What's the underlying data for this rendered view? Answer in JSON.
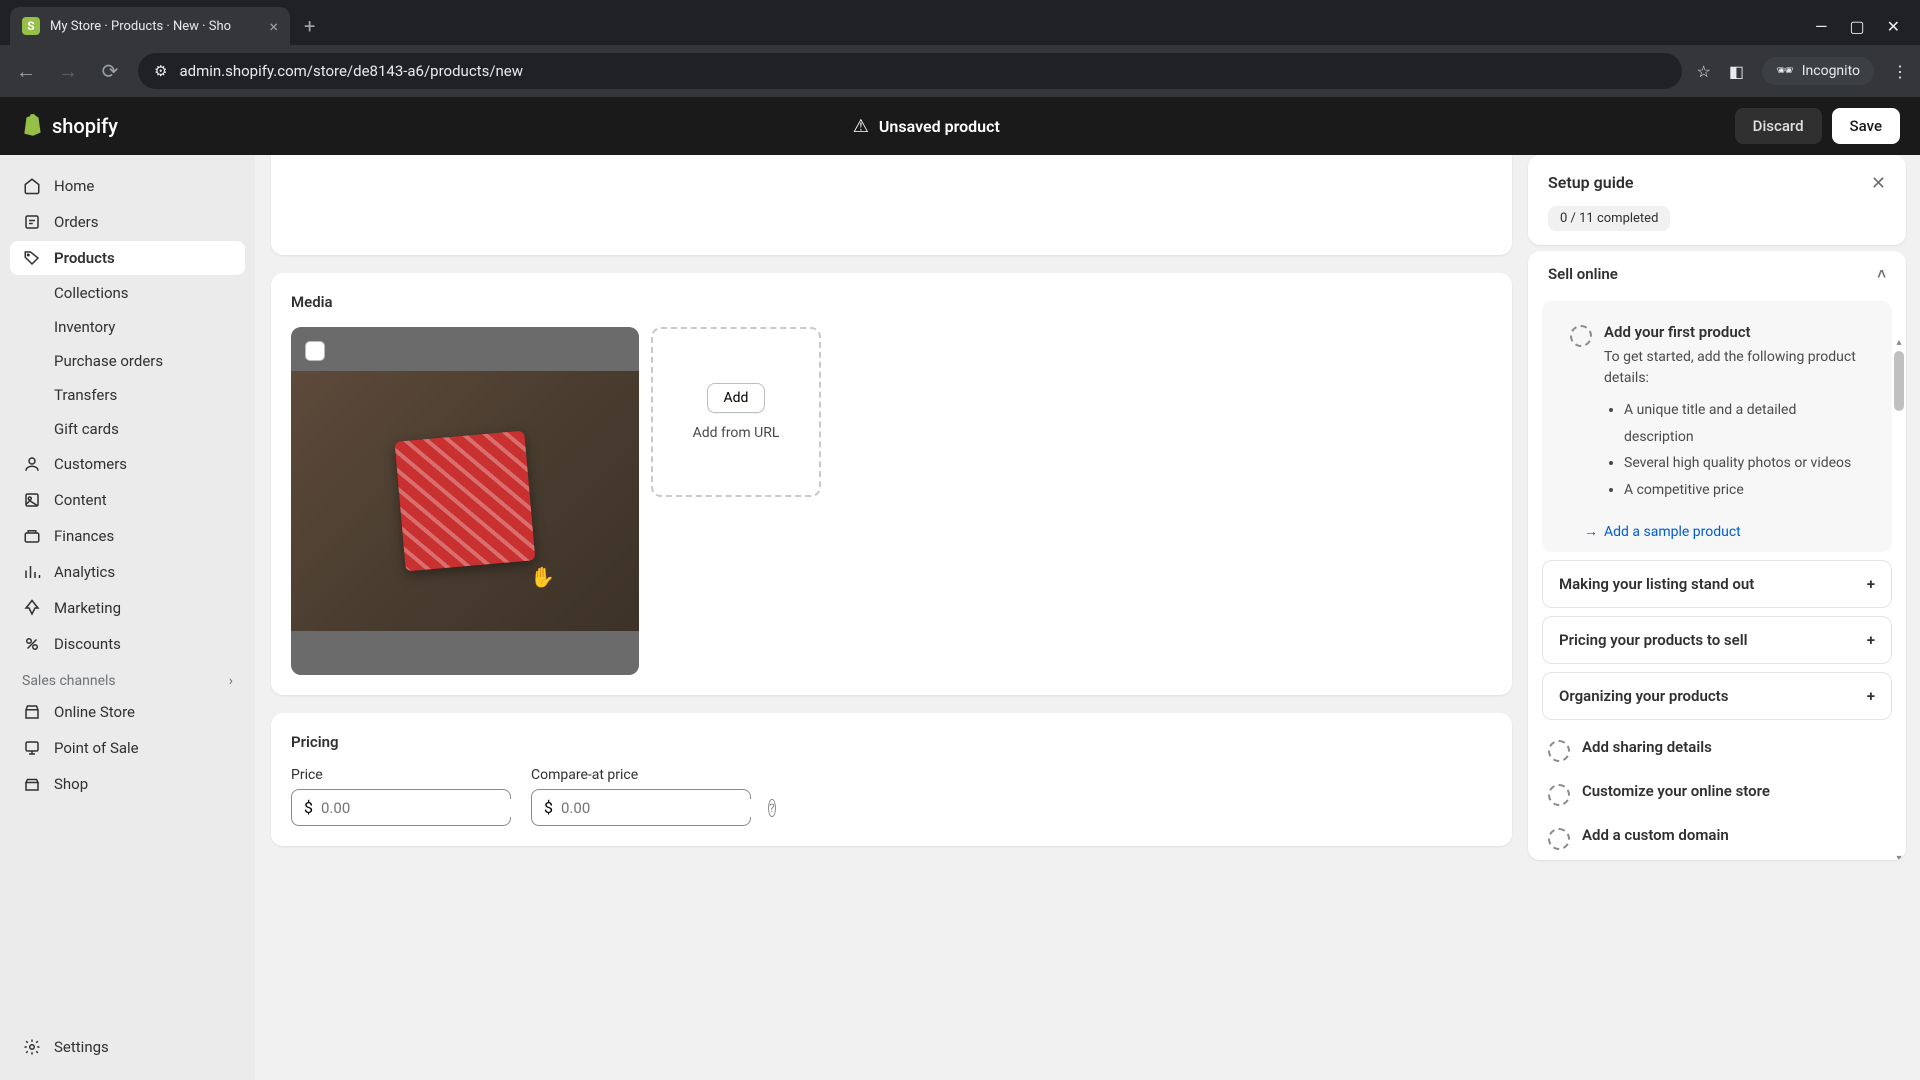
{
  "browser": {
    "tab_title": "My Store · Products · New · Sho",
    "url": "admin.shopify.com/store/de8143-a6/products/new",
    "incognito": "Incognito"
  },
  "header": {
    "logo_text": "shopify",
    "status": "Unsaved product",
    "discard": "Discard",
    "save": "Save"
  },
  "sidebar": {
    "home": "Home",
    "orders": "Orders",
    "products": "Products",
    "collections": "Collections",
    "inventory": "Inventory",
    "purchase_orders": "Purchase orders",
    "transfers": "Transfers",
    "gift_cards": "Gift cards",
    "customers": "Customers",
    "content": "Content",
    "finances": "Finances",
    "analytics": "Analytics",
    "marketing": "Marketing",
    "discounts": "Discounts",
    "sales_channels": "Sales channels",
    "online_store": "Online Store",
    "point_of_sale": "Point of Sale",
    "shop": "Shop",
    "settings": "Settings"
  },
  "media": {
    "title": "Media",
    "add": "Add",
    "add_from_url": "Add from URL"
  },
  "pricing": {
    "title": "Pricing",
    "price_label": "Price",
    "compare_label": "Compare-at price",
    "currency": "$",
    "placeholder": "0.00"
  },
  "setup": {
    "title": "Setup guide",
    "progress": "0 / 11 completed",
    "sell_online": "Sell online",
    "first_product_title": "Add your first product",
    "first_product_desc": "To get started, add the following product details:",
    "bullet1": "A unique title and a detailed description",
    "bullet2": "Several high quality photos or videos",
    "bullet3": "A competitive price",
    "sample_link": "Add a sample product",
    "making_stand_out": "Making your listing stand out",
    "pricing_products": "Pricing your products to sell",
    "organizing": "Organizing your products",
    "sharing": "Add sharing details",
    "customize": "Customize your online store",
    "custom_domain": "Add a custom domain"
  }
}
